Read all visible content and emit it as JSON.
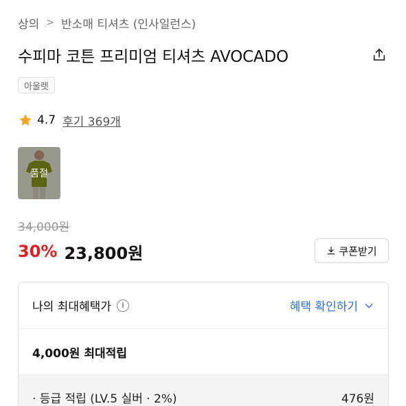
{
  "breadcrumb": {
    "category": "상의",
    "subcategory": "반소매 티셔츠 (인사일런스)"
  },
  "product": {
    "title": "수피마 코튼 프리미엄 티셔츠 AVOCADO",
    "tag": "아울렛",
    "rating": "4.7",
    "reviews_label": "후기 369개",
    "thumbnail_status": "품절",
    "original_price": "34,000원",
    "discount": "30%",
    "final_price": "23,800원"
  },
  "coupon": {
    "label": "쿠폰받기"
  },
  "benefit": {
    "title": "나의 최대혜택가",
    "info_icon_text": "i",
    "check_label": "혜택 확인하기",
    "max_reward": "4,000원 최대적립",
    "grade_label": "· 등급 적립 (LV.5 실버 · 2%)",
    "grade_value": "476원"
  },
  "colors": {
    "discount": "#e02020",
    "link": "#2b6fe0",
    "star": "#f5a623",
    "thumb_shirt": "#8a9a1c"
  },
  "icons": {
    "share": "share-icon",
    "star": "star-icon",
    "download": "download-icon",
    "info": "info-icon",
    "chevron": "chevron-down-icon"
  }
}
